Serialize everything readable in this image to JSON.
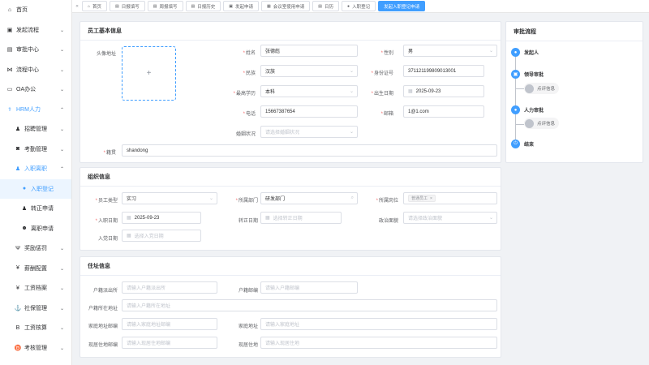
{
  "sidebar": {
    "items": [
      {
        "label": "首页",
        "icon": "home-icon",
        "glyph": "⌂"
      },
      {
        "label": "发起流程",
        "icon": "send-icon",
        "glyph": "▣",
        "arrow": "⌄"
      },
      {
        "label": "审批中心",
        "icon": "approval-icon",
        "glyph": "▤",
        "arrow": "⌄"
      },
      {
        "label": "流程中心",
        "icon": "flow-icon",
        "glyph": "⋈",
        "arrow": "⌄"
      },
      {
        "label": "OA办公",
        "icon": "monitor-icon",
        "glyph": "▭",
        "arrow": "⌄"
      },
      {
        "label": "HRM人力",
        "icon": "hrm-icon",
        "glyph": "⚕",
        "arrow": "⌃"
      },
      {
        "label": "招聘管理",
        "icon": "bell-icon",
        "glyph": "♟",
        "arrow": "⌄"
      },
      {
        "label": "考勤管理",
        "icon": "camera-icon",
        "glyph": "◙",
        "arrow": "⌄"
      },
      {
        "label": "入职离职",
        "icon": "bell-icon",
        "glyph": "♟",
        "arrow": "⌃"
      },
      {
        "label": "入职登记",
        "icon": "user-icon",
        "glyph": "●"
      },
      {
        "label": "转正申请",
        "icon": "bell-icon",
        "glyph": "♟"
      },
      {
        "label": "离职申请",
        "icon": "face-icon",
        "glyph": "☻"
      },
      {
        "label": "奖励惩罚",
        "icon": "trophy-icon",
        "glyph": "Ψ",
        "arrow": "⌄"
      },
      {
        "label": "薪酬配置",
        "icon": "money-icon",
        "glyph": "¥",
        "arrow": "⌄"
      },
      {
        "label": "工资档案",
        "icon": "money-icon",
        "glyph": "¥",
        "arrow": "⌄"
      },
      {
        "label": "社保管理",
        "icon": "anchor-icon",
        "glyph": "⚓",
        "arrow": "⌄"
      },
      {
        "label": "工资核算",
        "icon": "bitcoin-icon",
        "glyph": "B",
        "arrow": "⌄"
      },
      {
        "label": "考核管理",
        "icon": "medal-icon",
        "glyph": "♉",
        "arrow": "⌄"
      }
    ]
  },
  "tabs": [
    {
      "label": "首页",
      "glyph": "⌂"
    },
    {
      "label": "日报填写",
      "glyph": "▤"
    },
    {
      "label": "周报填写",
      "glyph": "▤"
    },
    {
      "label": "日报历史",
      "glyph": "▤"
    },
    {
      "label": "发起申请",
      "glyph": "▣"
    },
    {
      "label": "会议室使用申请",
      "glyph": "▦"
    },
    {
      "label": "日历",
      "glyph": "▤"
    },
    {
      "label": "入职登记",
      "glyph": "●"
    },
    {
      "label": "发起入职登记申请",
      "glyph": ""
    }
  ],
  "basic": {
    "title": "员工基本信息",
    "avatar_label": "头像地址",
    "avatar_plus": "+",
    "name_label": "姓名",
    "name_value": "张德彪",
    "gender_label": "性别",
    "gender_value": "男",
    "ethnic_label": "民族",
    "ethnic_value": "汉族",
    "idcard_label": "身份证号",
    "idcard_value": "371121199809013001",
    "edu_label": "最高学历",
    "edu_value": "本科",
    "birth_label": "出生日期",
    "birth_value": "2025-09-23",
    "phone_label": "电话",
    "phone_value": "15667387654",
    "email_label": "邮箱",
    "email_value": "1@1.com",
    "marriage_label": "婚姻状况",
    "marriage_placeholder": "请选择婚姻状况",
    "native_label": "籍贯",
    "native_value": "shandong"
  },
  "org": {
    "title": "组织信息",
    "type_label": "员工类型",
    "type_value": "实习",
    "dept_label": "所属部门",
    "dept_value": "研发部门",
    "post_label": "所属岗位",
    "post_tag": "普通员工",
    "entry_label": "入职日期",
    "entry_value": "2025-09-23",
    "regular_label": "转正日期",
    "regular_placeholder": "选择转正日期",
    "politic_label": "政治面貌",
    "politic_placeholder": "请选择政治面貌",
    "party_label": "入党日期",
    "party_placeholder": "选择入党日期"
  },
  "addr": {
    "title": "住址信息",
    "hukou_station_label": "户籍派出所",
    "hukou_station_ph": "请输入户籍派出所",
    "hukou_zip_label": "户籍邮编",
    "hukou_zip_ph": "请输入户籍邮编",
    "hukou_addr_label": "户籍所在地址",
    "hukou_addr_ph": "请输入户籍所在地址",
    "home_zip_label": "家庭地址邮编",
    "home_zip_ph": "请输入家庭地址邮编",
    "home_addr_label": "家庭地址",
    "home_addr_ph": "请输入家庭地址",
    "cur_zip_label": "现居住地邮编",
    "cur_zip_ph": "请输入现居住地邮编",
    "cur_addr_label": "现居住地",
    "cur_addr_ph": "请输入现居住地"
  },
  "flow": {
    "title": "审批流程",
    "start": "发起人",
    "leader": "领导审批",
    "leader_sign": "点评信息",
    "hr": "人力审批",
    "hr_sign": "点评信息",
    "end": "结束"
  },
  "colors": {
    "accent": "#409eff",
    "required": "#f56c6c"
  }
}
